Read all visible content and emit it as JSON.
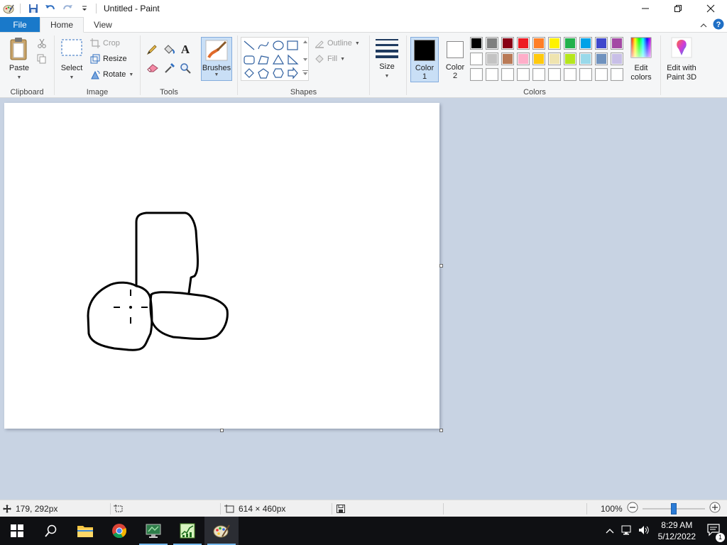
{
  "window": {
    "title": "Untitled - Paint"
  },
  "tabs": {
    "file": "File",
    "home": "Home",
    "view": "View"
  },
  "clipboard": {
    "paste": "Paste",
    "label": "Clipboard"
  },
  "image": {
    "select": "Select",
    "crop": "Crop",
    "resize": "Resize",
    "rotate": "Rotate",
    "label": "Image"
  },
  "tools": {
    "label": "Tools"
  },
  "brushes": {
    "label": "Brushes"
  },
  "shapes": {
    "outline": "Outline",
    "fill": "Fill",
    "label": "Shapes"
  },
  "size": {
    "label": "Size"
  },
  "colors": {
    "color1": "Color",
    "color1_num": "1",
    "color2": "Color",
    "color2_num": "2",
    "edit_colors_line1": "Edit",
    "edit_colors_line2": "colors",
    "paint3d_line1": "Edit with",
    "paint3d_line2": "Paint 3D",
    "label": "Colors",
    "color1_value": "#000000",
    "color2_value": "#ffffff",
    "row1": [
      "#000000",
      "#7f7f7f",
      "#880015",
      "#ed1c24",
      "#ff7f27",
      "#fff200",
      "#22b14c",
      "#00a2e8",
      "#3f48cc",
      "#a349a4"
    ],
    "row2": [
      "#ffffff",
      "#c3c3c3",
      "#b97a57",
      "#ffaec9",
      "#ffc90e",
      "#efe4b0",
      "#b5e61d",
      "#99d9ea",
      "#7092be",
      "#c8bfe7"
    ],
    "row3": [
      "#ffffff",
      "#ffffff",
      "#ffffff",
      "#ffffff",
      "#ffffff",
      "#ffffff",
      "#ffffff",
      "#ffffff",
      "#ffffff",
      "#ffffff"
    ]
  },
  "status": {
    "cursor_pos": "179, 292px",
    "canvas_size": "614 × 460px",
    "zoom": "100%"
  },
  "taskbar": {
    "time": "8:29 AM",
    "date": "5/12/2022",
    "notification_count": "1"
  }
}
